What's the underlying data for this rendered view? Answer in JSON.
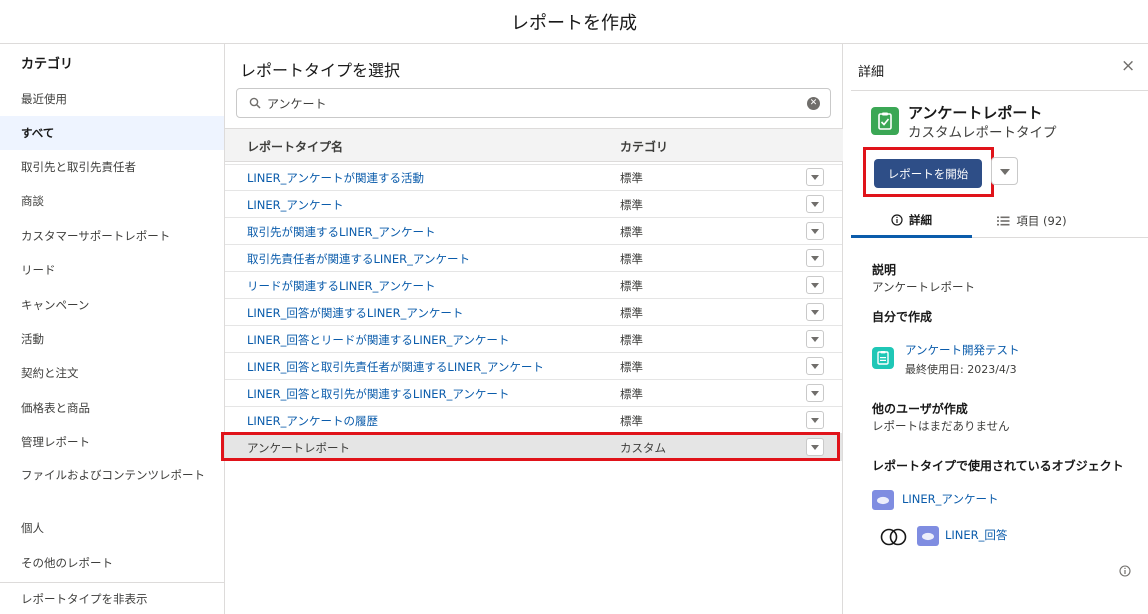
{
  "window": {
    "title": "レポートを作成"
  },
  "sidebar": {
    "heading": "カテゴリ",
    "items": [
      {
        "label": "最近使用"
      },
      {
        "label": "すべて"
      },
      {
        "label": "取引先と取引先責任者"
      },
      {
        "label": "商談"
      },
      {
        "label": "カスタマーサポートレポート"
      },
      {
        "label": "リード"
      },
      {
        "label": "キャンペーン"
      },
      {
        "label": "活動"
      },
      {
        "label": "契約と注文"
      },
      {
        "label": "価格表と商品"
      },
      {
        "label": "管理レポート"
      },
      {
        "label": "ファイルおよびコンテンツレポート"
      },
      {
        "label": "個人"
      },
      {
        "label": "その他のレポート"
      }
    ],
    "active_item": "すべて",
    "footer": "レポートタイプを非表示"
  },
  "middle": {
    "title": "レポートタイプを選択",
    "search": {
      "value": "アンケート"
    },
    "columns": {
      "name": "レポートタイプ名",
      "category": "カテゴリ"
    },
    "rows": [
      {
        "name": "LINER_アンケートが関連する活動",
        "category": "標準"
      },
      {
        "name": "LINER_アンケート",
        "category": "標準"
      },
      {
        "name": "取引先が関連するLINER_アンケート",
        "category": "標準"
      },
      {
        "name": "取引先責任者が関連するLINER_アンケート",
        "category": "標準"
      },
      {
        "name": "リードが関連するLINER_アンケート",
        "category": "標準"
      },
      {
        "name": "LINER_回答が関連するLINER_アンケート",
        "category": "標準"
      },
      {
        "name": "LINER_回答とリードが関連するLINER_アンケート",
        "category": "標準"
      },
      {
        "name": "LINER_回答と取引先責任者が関連するLINER_アンケート",
        "category": "標準"
      },
      {
        "name": "LINER_回答と取引先が関連するLINER_アンケート",
        "category": "標準"
      },
      {
        "name": "LINER_アンケートの履歴",
        "category": "標準"
      },
      {
        "name": "アンケートレポート",
        "category": "カスタム"
      }
    ],
    "selected_row": "アンケートレポート"
  },
  "detail": {
    "heading": "詳細",
    "close_label": "×",
    "report": {
      "title": "アンケートレポート",
      "subtitle": "カスタムレポートタイプ"
    },
    "start_button": "レポートを開始",
    "tabs": [
      {
        "label": "詳細",
        "icon": "info-icon"
      },
      {
        "label": "項目 (92)",
        "icon": "list-icon"
      }
    ],
    "description_label": "説明",
    "description_text": "アンケートレポート",
    "created_by_me_label": "自分で作成",
    "own_report": {
      "name": "アンケート開発テスト",
      "meta": "最終使用日: 2023/4/3"
    },
    "created_by_others_label": "他のユーザが作成",
    "created_by_others_text": "レポートはまだありません",
    "objects_label": "レポートタイプで使用されているオブジェクト",
    "objects": [
      {
        "name": "LINER_アンケート"
      },
      {
        "name": "LINER_回答"
      }
    ]
  },
  "colors": {
    "accent": "#0b5cab",
    "primary_button": "#2e4e87",
    "highlight": "#e0131a",
    "report_icon": "#3ba755",
    "own_report_icon": "#1fc7b6",
    "object_icon": "#7f8de1"
  }
}
